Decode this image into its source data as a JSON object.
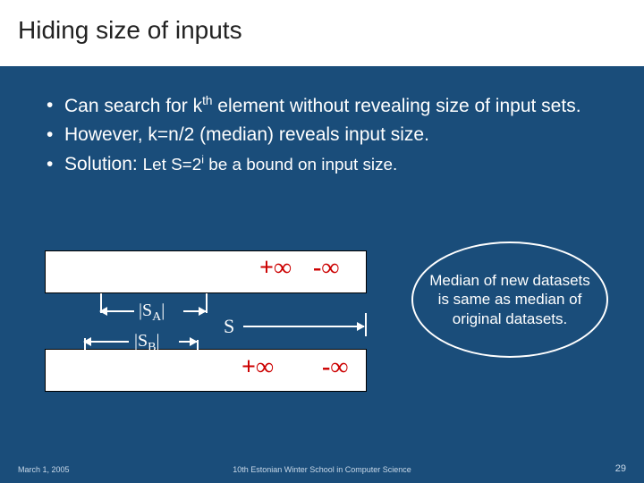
{
  "title": "Hiding size of inputs",
  "bullets": {
    "b1_pre": "Can search for k",
    "b1_sup": "th",
    "b1_post": " element without revealing size of input sets.",
    "b2": "However, k=n/2 (median) reveals input size.",
    "b3_pre": "Solution: ",
    "b3_mid": "Let S=2",
    "b3_sup": "i",
    "b3_post": " be a bound on input size."
  },
  "diagram": {
    "plus_inf": "+∞",
    "minus_inf": "-∞",
    "SA": "|S",
    "SA_sub": "A",
    "SA_end": "|",
    "SB": "|S",
    "SB_sub": "B",
    "SB_end": "|",
    "S": "S"
  },
  "oval": "Median of new datasets is same as median of original datasets.",
  "footer": {
    "date": "March 1, 2005",
    "venue": "10th Estonian Winter School in Computer Science",
    "page": "29"
  }
}
